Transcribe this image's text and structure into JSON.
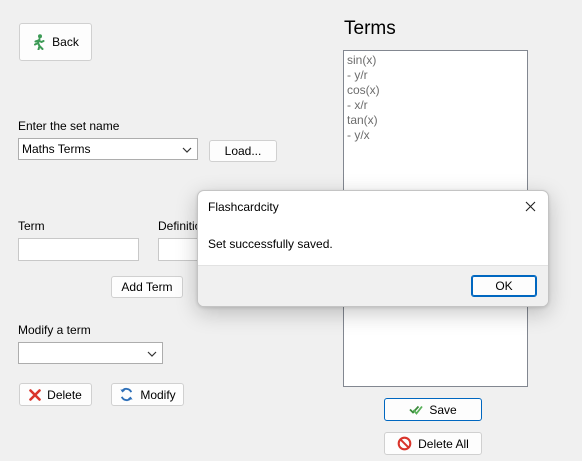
{
  "back_button": {
    "label": "Back",
    "icon": "walking-person-icon"
  },
  "set_name": {
    "label": "Enter the set name",
    "selected": "Maths Terms",
    "load_label": "Load..."
  },
  "term": {
    "label": "Term",
    "value": ""
  },
  "definition": {
    "label": "Definition",
    "value": ""
  },
  "add_term_label": "Add Term",
  "modify_term": {
    "label": "Modify a term",
    "selected": ""
  },
  "delete_label": "Delete",
  "modify_label": "Modify",
  "terms_panel": {
    "title": "Terms",
    "items": [
      "sin(x)",
      "- y/r",
      "cos(x)",
      "- x/r",
      "tan(x)",
      "- y/x"
    ]
  },
  "save_label": "Save",
  "delete_all_label": "Delete All",
  "dialog": {
    "title": "Flashcardcity",
    "message": "Set successfully saved.",
    "ok_label": "OK"
  },
  "colors": {
    "accent": "#0067c0",
    "save_check": "#3a8a3a",
    "delete_red": "#d9342b",
    "refresh_blue": "#2d6fb8"
  }
}
